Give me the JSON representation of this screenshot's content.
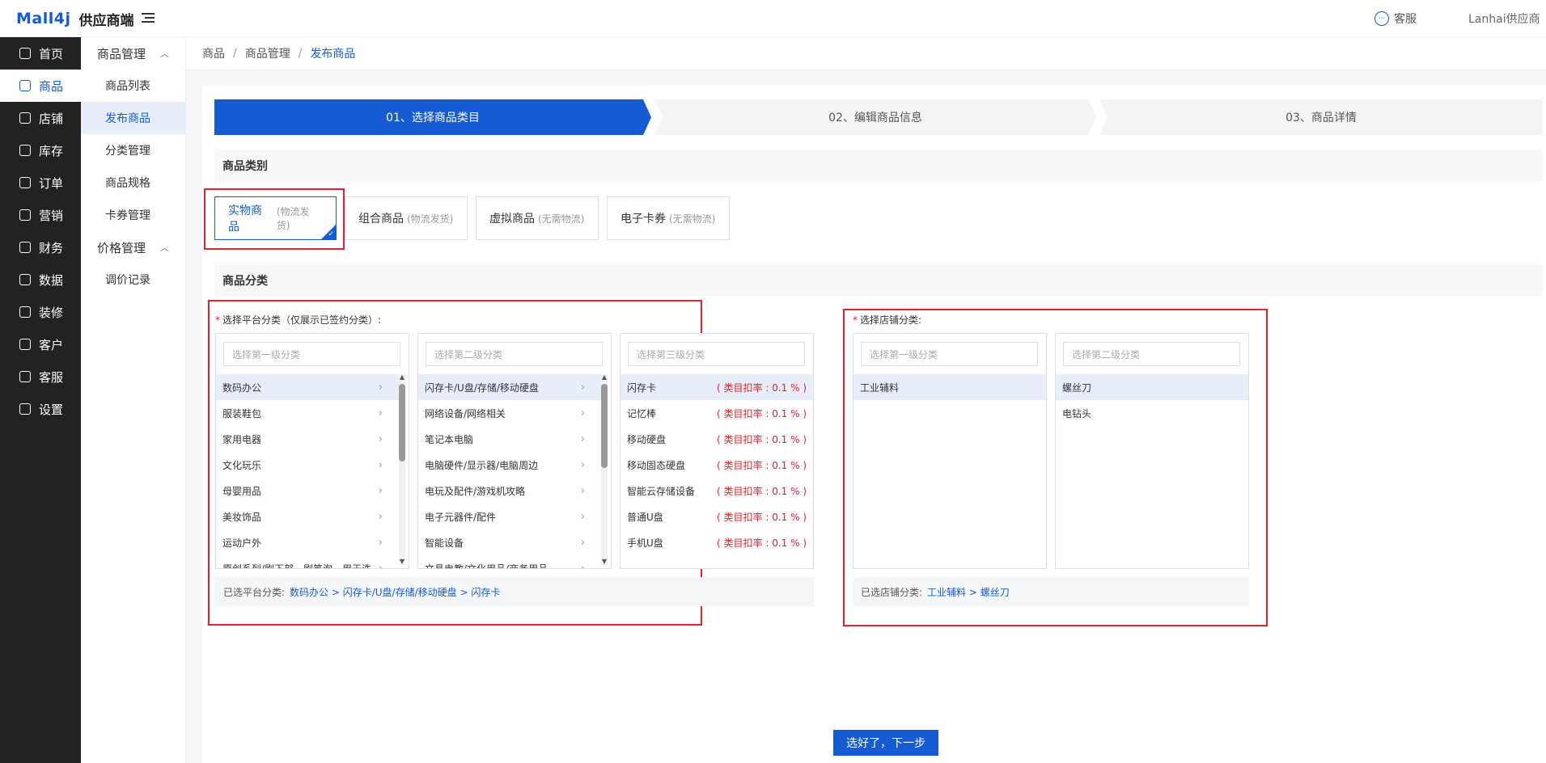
{
  "header": {
    "logo_mark": "Mall4j",
    "logo_text": "供应商端",
    "service_label": "客服",
    "user_label": "Lanhai供应商"
  },
  "sidebar": {
    "items": [
      {
        "label": "首页",
        "icon": "home-icon"
      },
      {
        "label": "商品",
        "icon": "goods-icon",
        "active": true
      },
      {
        "label": "店铺",
        "icon": "store-icon"
      },
      {
        "label": "库存",
        "icon": "stock-icon"
      },
      {
        "label": "订单",
        "icon": "order-icon"
      },
      {
        "label": "营销",
        "icon": "gift-icon"
      },
      {
        "label": "财务",
        "icon": "finance-icon"
      },
      {
        "label": "数据",
        "icon": "data-icon"
      },
      {
        "label": "装修",
        "icon": "decorate-icon"
      },
      {
        "label": "客户",
        "icon": "user-icon"
      },
      {
        "label": "客服",
        "icon": "chat-icon"
      },
      {
        "label": "设置",
        "icon": "gear-icon"
      }
    ]
  },
  "submenu": {
    "group1": "商品管理",
    "items1": [
      "商品列表",
      "发布商品",
      "分类管理",
      "商品规格",
      "卡券管理"
    ],
    "group2": "价格管理",
    "items2": [
      "调价记录"
    ]
  },
  "breadcrumb": [
    "商品",
    "商品管理",
    "发布商品"
  ],
  "steps": [
    "01、选择商品类目",
    "02、编辑商品信息",
    "03、商品详情"
  ],
  "section_type": "商品类别",
  "types": [
    {
      "name": "实物商品",
      "hint": "(物流发货)"
    },
    {
      "name": "组合商品",
      "hint": "(物流发货)"
    },
    {
      "name": "虚拟商品",
      "hint": "(无需物流)"
    },
    {
      "name": "电子卡券",
      "hint": "(无需物流)"
    }
  ],
  "section_category": "商品分类",
  "platform": {
    "label": "选择平台分类（仅展示已签约分类）:",
    "search1": "选择第一级分类",
    "search2": "选择第二级分类",
    "search3": "选择第三级分类",
    "level1": [
      "数码办公",
      "服装鞋包",
      "家用电器",
      "文化玩乐",
      "母婴用品",
      "美妆饰品",
      "运动户外",
      "原创系列/刷下部 - 刷笔泡 - 用于洗"
    ],
    "level2": [
      "闪存卡/U盘/存储/移动硬盘",
      "网络设备/网络相关",
      "笔记本电脑",
      "电脑硬件/显示器/电脑周边",
      "电玩及配件/游戏机攻略",
      "电子元器件/配件",
      "智能设备",
      "文具电教/文化用品/商务用品"
    ],
    "level3": [
      "闪存卡",
      "记忆棒",
      "移动硬盘",
      "移动固态硬盘",
      "智能云存储设备",
      "普通U盘",
      "手机U盘"
    ],
    "rate_text": "( 类目扣率 : 0.1 % )",
    "selected_label": "已选平台分类:",
    "selected_path": "数码办公 >  闪存卡/U盘/存储/移动硬盘 >  闪存卡"
  },
  "shop": {
    "label": "选择店铺分类:",
    "search1": "选择第一级分类",
    "search2": "选择第二级分类",
    "level1": [
      "工业辅料"
    ],
    "level2": [
      "螺丝刀",
      "电钻头"
    ],
    "selected_label": "已选店铺分类:",
    "selected_path": "工业辅料 >  螺丝刀"
  },
  "next_button": "选好了，下一步"
}
